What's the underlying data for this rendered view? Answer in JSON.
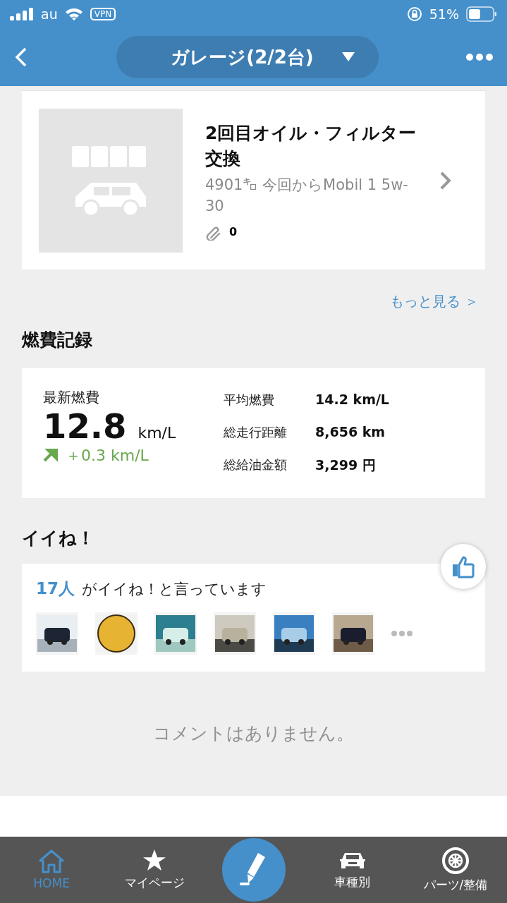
{
  "status_bar": {
    "carrier": "au",
    "vpn": "VPN",
    "battery": "51%"
  },
  "nav": {
    "title": "ガレージ(2/2台)"
  },
  "record": {
    "title": "2回目オイル・フィルター交換",
    "detail": "4901㌔ 今回からMobil 1 5w-30",
    "attachments": "0"
  },
  "more_link": "もっと見る ＞",
  "fuel": {
    "heading": "燃費記録",
    "latest_label": "最新燃費",
    "latest_value": "12.8",
    "latest_unit": "km/L",
    "change": "＋0.3 km/L",
    "stats": [
      {
        "label": "平均燃費",
        "value": "14.2 km/L"
      },
      {
        "label": "総走行距離",
        "value": "8,656 km"
      },
      {
        "label": "総給油金額",
        "value": "3,299 円"
      }
    ]
  },
  "likes": {
    "heading": "イイね！",
    "count": "17人",
    "text": "がイイね！と言っています"
  },
  "comments": {
    "empty": "コメントはありません。"
  },
  "tab_bar": [
    {
      "label": "HOME",
      "kind": "home",
      "selected": true
    },
    {
      "label": "マイページ",
      "kind": "star",
      "selected": false
    },
    {
      "kind": "post"
    },
    {
      "label": "車種別",
      "kind": "car",
      "selected": false
    },
    {
      "label": "パーツ/整備",
      "kind": "wheel",
      "selected": false
    }
  ]
}
